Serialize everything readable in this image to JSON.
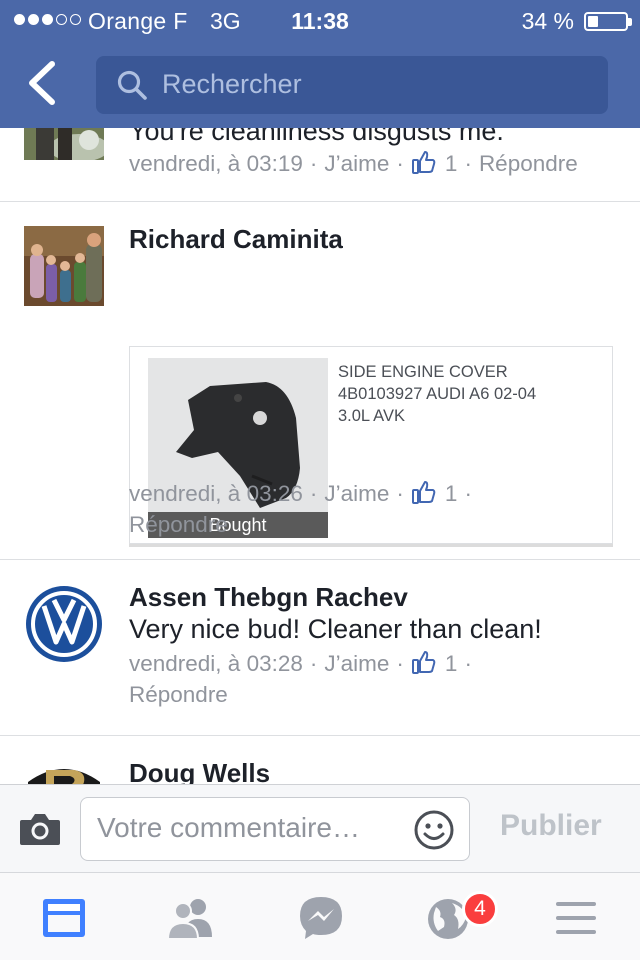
{
  "status_bar": {
    "carrier": "Orange F",
    "network": "3G",
    "time": "11:38",
    "battery": "34 %",
    "battery_level": 0.34,
    "signal_bars": 3,
    "signal_max": 5
  },
  "nav": {
    "back_icon": "chevron-left-icon",
    "search_placeholder": "Rechercher"
  },
  "comments": [
    {
      "author": "",
      "text": "You're cleanliness disgusts me.",
      "time": "vendredi, à 03:19",
      "like_label": "J’aime",
      "like_count": "1",
      "reply_label": "Répondre"
    },
    {
      "author": "Richard Caminita",
      "time": "vendredi, à 03:26",
      "like_label": "J’aime",
      "like_count": "1",
      "reply_label": "Répondre",
      "attachment": {
        "image_caption": "Bought",
        "description_lines": [
          "SIDE ENGINE COVER",
          "4B0103927 AUDI A6 02-04",
          "3.0L AVK"
        ]
      }
    },
    {
      "author": "Assen Thebgn Rachev",
      "text": "Very nice bud! Cleaner than clean!",
      "time": "vendredi, à 03:28",
      "like_label": "J’aime",
      "like_count": "1",
      "reply_label": "Répondre"
    },
    {
      "author": "Doug Wells"
    }
  ],
  "composer": {
    "placeholder": "Votre commentaire…",
    "publish_label": "Publier"
  },
  "tabs": [
    {
      "icon": "news-feed-icon",
      "active": true
    },
    {
      "icon": "friend-requests-icon"
    },
    {
      "icon": "messenger-icon"
    },
    {
      "icon": "notifications-globe-icon",
      "badge": "4"
    },
    {
      "icon": "menu-icon"
    }
  ],
  "colors": {
    "brand_blue": "#4b68a8",
    "search_bg": "#3a5796",
    "meta_gray": "#90949c",
    "badge_red": "#fa3e3e",
    "active_tab": "#4080ff"
  }
}
